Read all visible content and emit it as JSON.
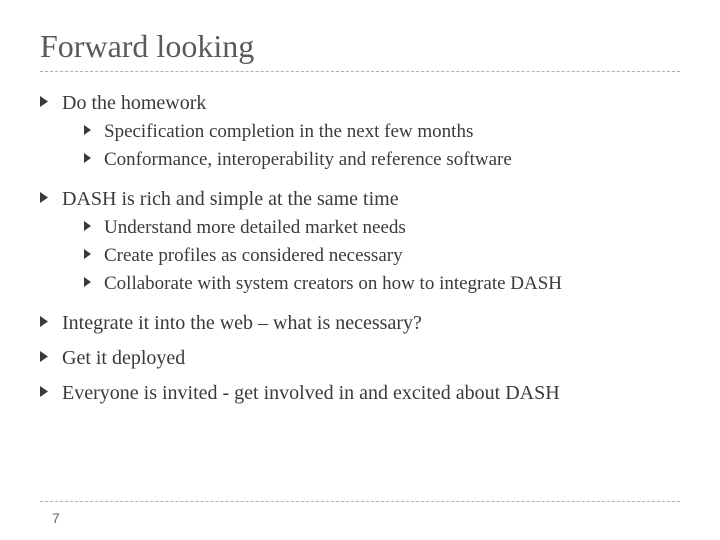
{
  "title": "Forward looking",
  "bullets": {
    "b0": "Do the homework",
    "b0s0": "Specification completion in the next few months",
    "b0s1": "Conformance, interoperability and reference software",
    "b1": "DASH is rich and simple at the same time",
    "b1s0": "Understand more detailed market needs",
    "b1s1": "Create profiles as considered necessary",
    "b1s2": "Collaborate with system creators on how to integrate DASH",
    "b2": "Integrate it into the web – what is necessary?",
    "b3": "Get it deployed",
    "b4": "Everyone is invited - get involved in and excited about DASH"
  },
  "page_number": "7"
}
